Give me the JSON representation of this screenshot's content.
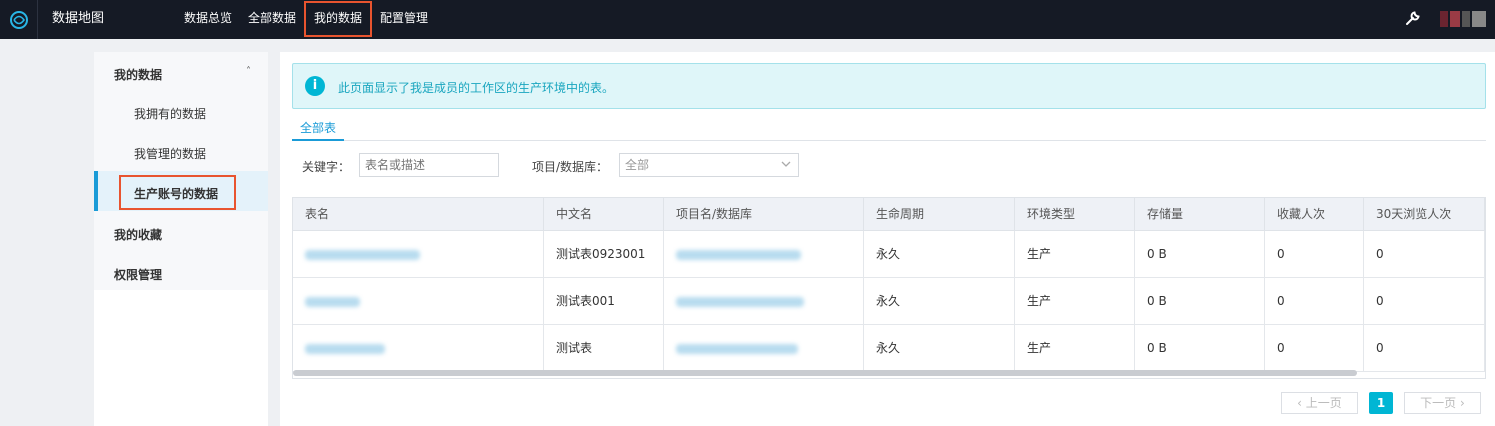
{
  "header": {
    "app_title": "数据地图",
    "nav": [
      "数据总览",
      "全部数据",
      "我的数据",
      "配置管理"
    ],
    "active_nav": "我的数据"
  },
  "sidebar": {
    "group_title": "我的数据",
    "items": [
      "我拥有的数据",
      "我管理的数据",
      "生产账号的数据"
    ],
    "active_item": "生产账号的数据",
    "favorites": "我的收藏",
    "permissions": "权限管理"
  },
  "notice": {
    "text": "此页面显示了我是成员的工作区的生产环境中的表。"
  },
  "tabs": [
    "全部表"
  ],
  "filters": {
    "keyword_label": "关键字：",
    "keyword_placeholder": "表名或描述",
    "project_label": "项目/数据库：",
    "project_value": "全部"
  },
  "table": {
    "columns": [
      "表名",
      "中文名",
      "项目名/数据库",
      "生命周期",
      "环境类型",
      "存储量",
      "收藏人次",
      "30天浏览人次"
    ],
    "rows": [
      {
        "chinese_name": "测试表0923001",
        "lifecycle": "永久",
        "env": "生产",
        "storage": "0 B",
        "favorites": "0",
        "views_30d": "0"
      },
      {
        "chinese_name": "测试表001",
        "lifecycle": "永久",
        "env": "生产",
        "storage": "0 B",
        "favorites": "0",
        "views_30d": "0"
      },
      {
        "chinese_name": "测试表",
        "lifecycle": "永久",
        "env": "生产",
        "storage": "0 B",
        "favorites": "0",
        "views_30d": "0"
      }
    ]
  },
  "pagination": {
    "prev": "上一页",
    "current": "1",
    "next": "下一页"
  },
  "colors": {
    "accent": "#1a9bd7",
    "highlight_border": "#e8542f",
    "topbar": "#151a25",
    "info": "#00b6d4"
  }
}
